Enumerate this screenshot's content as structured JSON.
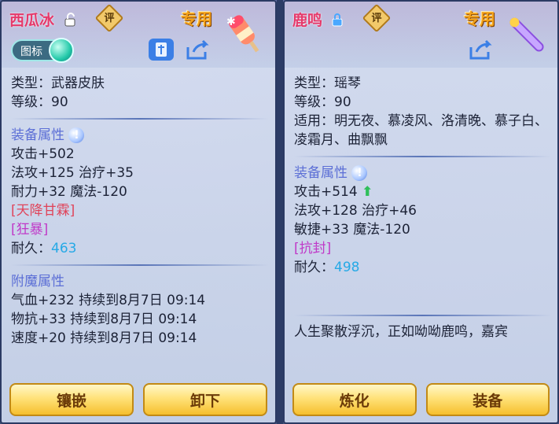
{
  "left": {
    "name": "西瓜冰",
    "rate_label": "评",
    "exclusive": "专用",
    "toggle_label": "图标",
    "type": "类型：武器皮肤",
    "level": "等级：90",
    "equip_title": "装备属性",
    "stats": [
      "攻击+502",
      "法攻+125 治疗+35",
      "耐力+32 魔法-120"
    ],
    "tags": [
      "[天降甘霖]",
      "[狂暴]"
    ],
    "durability_label": "耐久：",
    "durability_value": "463",
    "enchant_title": "附魔属性",
    "enchants": [
      "气血+232 持续到8月7日 09:14",
      "物抗+33 持续到8月7日 09:14",
      "速度+20 持续到8月7日 09:14"
    ],
    "buttons": [
      "镶嵌",
      "卸下"
    ]
  },
  "right": {
    "name": "鹿鸣",
    "rate_label": "评",
    "exclusive": "专用",
    "type": "类型：瑶琴",
    "level": "等级：90",
    "applicable": "适用：明无夜、慕凌风、洛清晚、慕子白、凌霜月、曲飘飘",
    "equip_title": "装备属性",
    "stats": [
      "攻击+514",
      "法攻+128 治疗+46",
      "敏捷+33 魔法-120"
    ],
    "tags": [
      "[抗封]"
    ],
    "durability_label": "耐久：",
    "durability_value": "498",
    "description": "人生聚散浮沉，正如呦呦鹿鸣，嘉宾",
    "buttons": [
      "炼化",
      "装备"
    ]
  }
}
